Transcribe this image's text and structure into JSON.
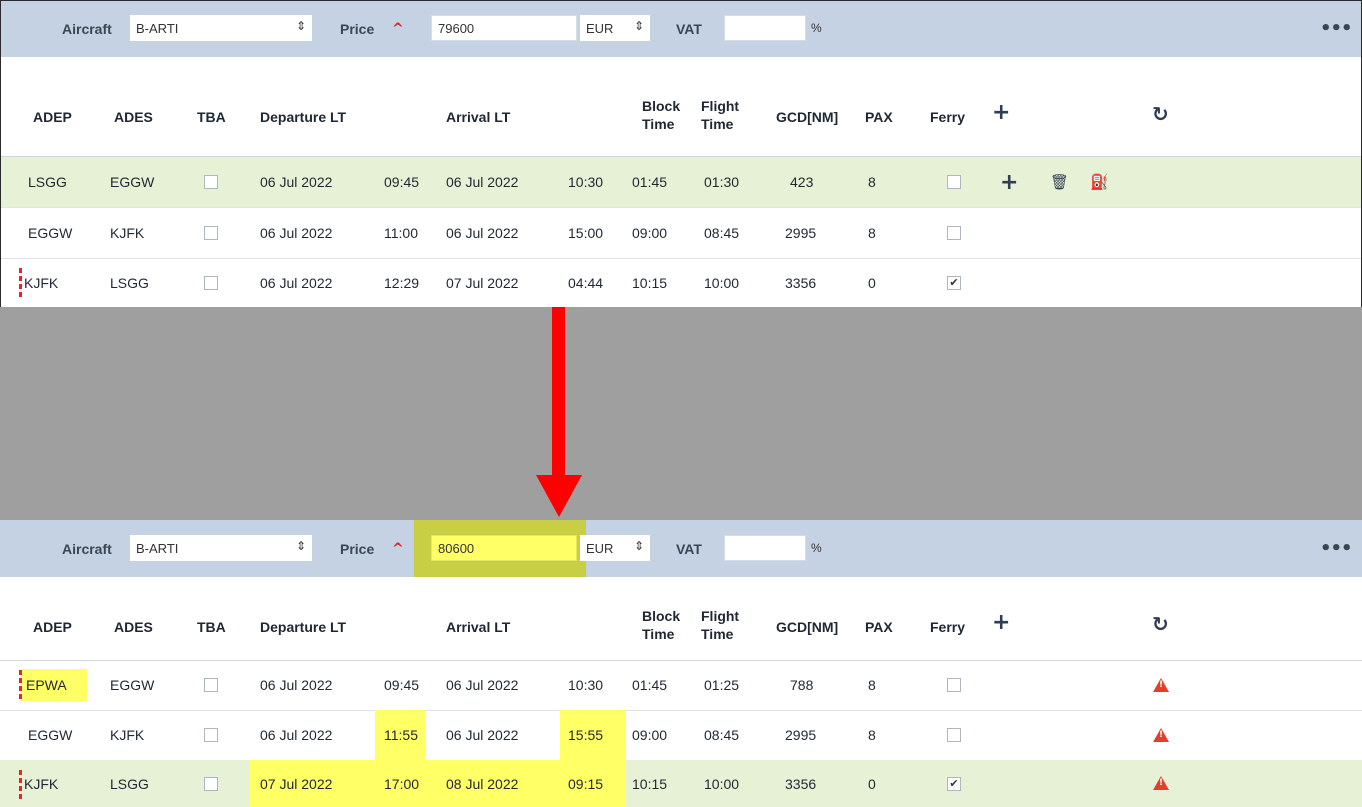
{
  "colors": {
    "toolbar_bg": "#c5d2e3",
    "row_highlight": "#e7f1d6",
    "change_highlight": "#ffff66",
    "arrow": "#ff0000",
    "warning": "#e2402a"
  },
  "toolbar": {
    "aircraft_label": "Aircraft",
    "aircraft_value": "B-ARTI",
    "price_label": "Price",
    "currency": "EUR",
    "vat_label": "VAT",
    "vat_value": "",
    "vat_unit": "%",
    "more_icon": "ellipsis-icon"
  },
  "columns": {
    "adep": "ADEP",
    "ades": "ADES",
    "tba": "TBA",
    "departure": "Departure LT",
    "arrival": "Arrival LT",
    "block1": "Block",
    "block2": "Time",
    "flight1": "Flight",
    "flight2": "Time",
    "gcd": "GCD[NM]",
    "pax": "PAX",
    "ferry": "Ferry"
  },
  "before": {
    "price": "79600",
    "rows": [
      {
        "adep": "LSGG",
        "ades": "EGGW",
        "tba": false,
        "dep_date": "06 Jul 2022",
        "dep_time": "09:45",
        "arr_date": "06 Jul 2022",
        "arr_time": "10:30",
        "block": "01:45",
        "flight": "01:30",
        "gcd": "423",
        "pax": "8",
        "ferry": false
      },
      {
        "adep": "EGGW",
        "ades": "KJFK",
        "tba": false,
        "dep_date": "06 Jul 2022",
        "dep_time": "11:00",
        "arr_date": "06 Jul 2022",
        "arr_time": "15:00",
        "block": "09:00",
        "flight": "08:45",
        "gcd": "2995",
        "pax": "8",
        "ferry": false
      },
      {
        "adep": "KJFK",
        "ades": "LSGG",
        "tba": false,
        "dep_date": "06 Jul 2022",
        "dep_time": "12:29",
        "arr_date": "07 Jul 2022",
        "arr_time": "04:44",
        "block": "10:15",
        "flight": "10:00",
        "gcd": "3356",
        "pax": "0",
        "ferry": true
      }
    ]
  },
  "after": {
    "price": "80600",
    "rows": [
      {
        "adep": "EPWA",
        "ades": "EGGW",
        "tba": false,
        "dep_date": "06 Jul 2022",
        "dep_time": "09:45",
        "arr_date": "06 Jul 2022",
        "arr_time": "10:30",
        "block": "01:45",
        "flight": "01:25",
        "gcd": "788",
        "pax": "8",
        "ferry": false
      },
      {
        "adep": "EGGW",
        "ades": "KJFK",
        "tba": false,
        "dep_date": "06 Jul 2022",
        "dep_time": "11:55",
        "arr_date": "06 Jul 2022",
        "arr_time": "15:55",
        "block": "09:00",
        "flight": "08:45",
        "gcd": "2995",
        "pax": "8",
        "ferry": false
      },
      {
        "adep": "KJFK",
        "ades": "LSGG",
        "tba": false,
        "dep_date": "07 Jul 2022",
        "dep_time": "17:00",
        "arr_date": "08 Jul 2022",
        "arr_time": "09:15",
        "block": "10:15",
        "flight": "10:00",
        "gcd": "3356",
        "pax": "0",
        "ferry": true
      }
    ]
  }
}
